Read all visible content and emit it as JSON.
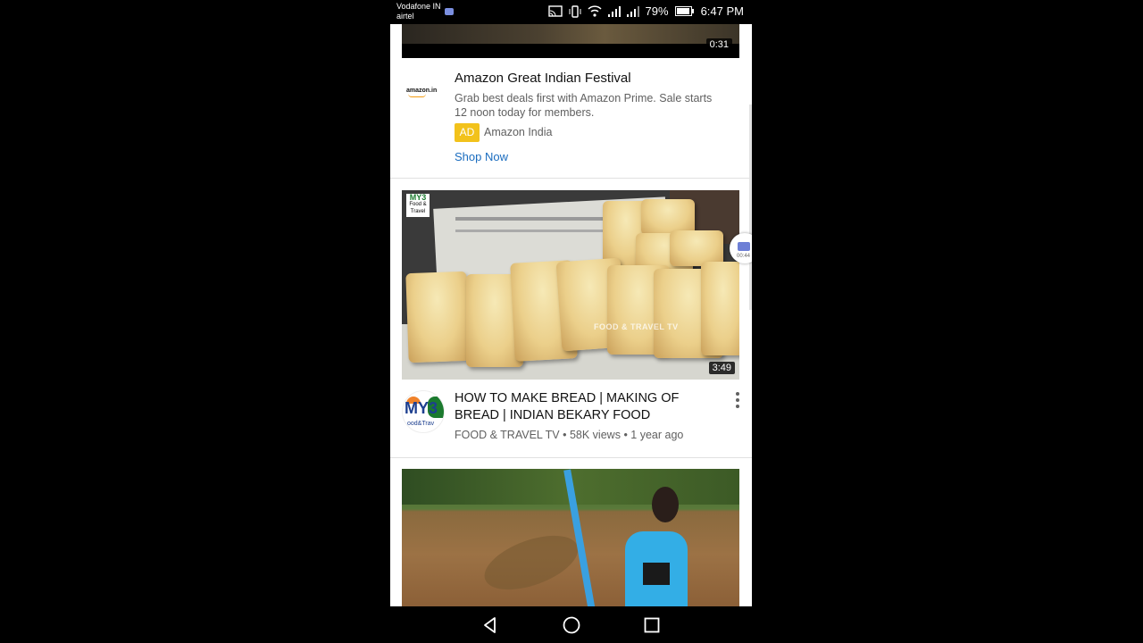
{
  "status_bar": {
    "carrier_line1": "Vodafone IN",
    "carrier_line2": "airtel",
    "battery": "79%",
    "time": "6:47 PM"
  },
  "top_video": {
    "duration": "0:31"
  },
  "ad": {
    "logo_text": "amazon.in",
    "title": "Amazon Great Indian Festival",
    "description": "Grab best deals first with Amazon Prime. Sale starts 12 noon today for members.",
    "badge": "AD",
    "advertiser": "Amazon India",
    "cta": "Shop Now"
  },
  "video": {
    "channel_tag_top": "MY3",
    "channel_tag_bottom": "Food & Travel",
    "watermark": "FOOD & TRAVEL TV",
    "duration": "3:49",
    "avatar_text": "MY3",
    "avatar_sub": "ood&Trav",
    "title": "HOW TO MAKE BREAD | MAKING OF BREAD | INDIAN BEKARY FOOD",
    "channel": "FOOD & TRAVEL TV",
    "views": "58K views",
    "age": "1 year ago"
  },
  "floating_recorder": {
    "time": "00:44"
  },
  "colors": {
    "ad_badge": "#f2c21b",
    "link": "#1a6cbf",
    "secondary_text": "#606060"
  }
}
